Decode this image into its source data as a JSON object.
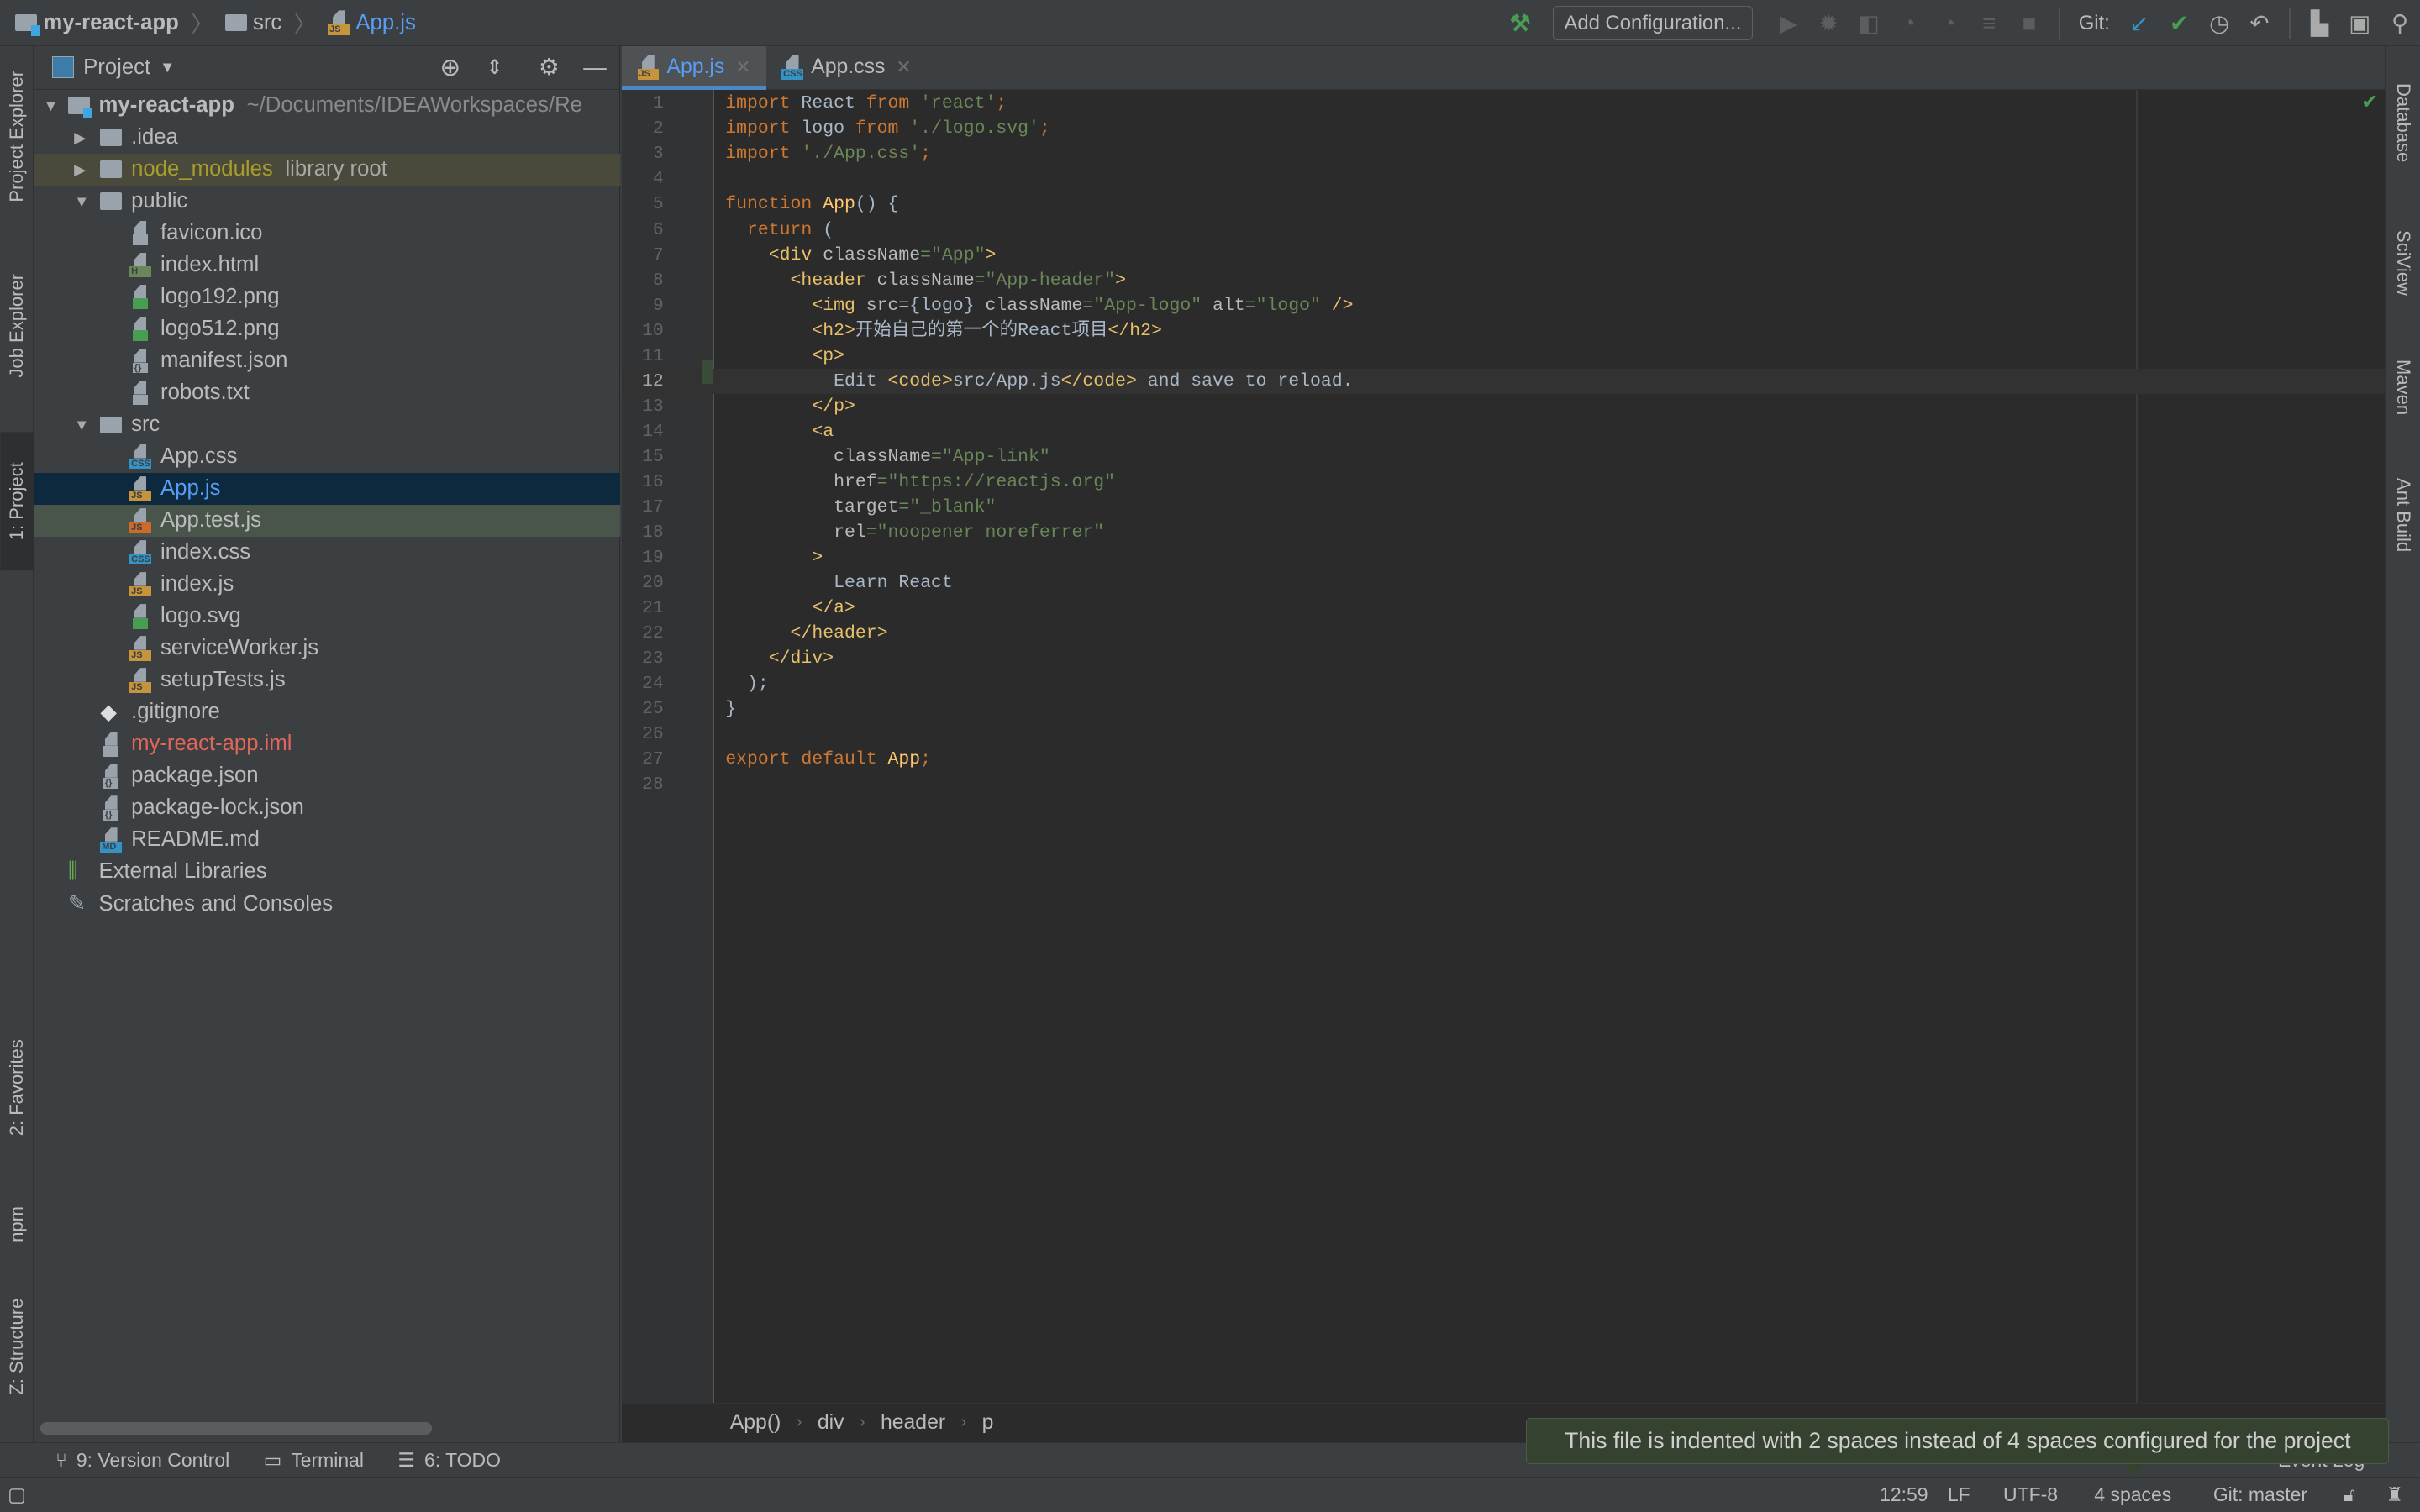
{
  "navbar": {
    "project": "my-react-app",
    "folder": "src",
    "file": "App.js"
  },
  "toolbar": {
    "add_configuration": "Add Configuration...",
    "git_label": "Git:"
  },
  "left_strip": {
    "project_explorer": "Project Explorer",
    "job_explorer": "Job Explorer",
    "project": "1: Project",
    "favorites": "2: Favorites",
    "npm": "npm",
    "structure": "Z: Structure"
  },
  "right_strip": {
    "database": "Database",
    "sciview": "SciView",
    "maven": "Maven",
    "ant_build": "Ant Build"
  },
  "project_panel": {
    "title": "Project",
    "tree": [
      {
        "depth": 0,
        "arrow": "open",
        "icon": "module",
        "name": "my-react-app",
        "bold": true,
        "extra": "~/Documents/IDEAWorkspaces/Re"
      },
      {
        "depth": 1,
        "arrow": "closed",
        "icon": "folder",
        "name": ".idea"
      },
      {
        "depth": 1,
        "arrow": "closed",
        "icon": "folder",
        "name": "node_modules",
        "extra": "library root",
        "state": "excluded"
      },
      {
        "depth": 1,
        "arrow": "open",
        "icon": "folder",
        "name": "public"
      },
      {
        "depth": 2,
        "icon": "gen",
        "name": "favicon.ico"
      },
      {
        "depth": 2,
        "icon": "html",
        "name": "index.html"
      },
      {
        "depth": 2,
        "icon": "img",
        "name": "logo192.png"
      },
      {
        "depth": 2,
        "icon": "img",
        "name": "logo512.png"
      },
      {
        "depth": 2,
        "icon": "json",
        "name": "manifest.json"
      },
      {
        "depth": 2,
        "icon": "gen",
        "name": "robots.txt"
      },
      {
        "depth": 1,
        "arrow": "open",
        "icon": "folder",
        "name": "src"
      },
      {
        "depth": 2,
        "icon": "css",
        "name": "App.css"
      },
      {
        "depth": 2,
        "icon": "js",
        "name": "App.js",
        "state": "selected"
      },
      {
        "depth": 2,
        "icon": "jt",
        "name": "App.test.js",
        "state": "test"
      },
      {
        "depth": 2,
        "icon": "css",
        "name": "index.css"
      },
      {
        "depth": 2,
        "icon": "js",
        "name": "index.js"
      },
      {
        "depth": 2,
        "icon": "img",
        "name": "logo.svg"
      },
      {
        "depth": 2,
        "icon": "js",
        "name": "serviceWorker.js"
      },
      {
        "depth": 2,
        "icon": "js",
        "name": "setupTests.js"
      },
      {
        "depth": 1,
        "icon": "git",
        "name": ".gitignore"
      },
      {
        "depth": 1,
        "icon": "gen",
        "name": "my-react-app.iml",
        "state": "error"
      },
      {
        "depth": 1,
        "icon": "json",
        "name": "package.json"
      },
      {
        "depth": 1,
        "icon": "json",
        "name": "package-lock.json"
      },
      {
        "depth": 1,
        "icon": "md",
        "name": "README.md"
      },
      {
        "depth": 0,
        "icon": "lib",
        "name": "External Libraries"
      },
      {
        "depth": 0,
        "icon": "scratch",
        "name": "Scratches and Consoles"
      }
    ]
  },
  "editor": {
    "tabs": [
      {
        "label": "App.js",
        "icon": "js",
        "active": true
      },
      {
        "label": "App.css",
        "icon": "css",
        "active": false
      }
    ],
    "current_line": 12,
    "lines": [
      [
        [
          "kw",
          "import "
        ],
        [
          "txt",
          "React "
        ],
        [
          "kw",
          "from "
        ],
        [
          "str",
          "'react'"
        ],
        [
          "kw",
          ";"
        ]
      ],
      [
        [
          "kw",
          "import "
        ],
        [
          "txt",
          "logo "
        ],
        [
          "kw",
          "from "
        ],
        [
          "str",
          "'./logo.svg'"
        ],
        [
          "kw",
          ";"
        ]
      ],
      [
        [
          "kw",
          "import "
        ],
        [
          "str",
          "'./App.css'"
        ],
        [
          "kw",
          ";"
        ]
      ],
      [],
      [
        [
          "kw",
          "function "
        ],
        [
          "fn",
          "App"
        ],
        [
          "txt",
          "() {"
        ]
      ],
      [
        [
          "txt",
          "  "
        ],
        [
          "kw",
          "return "
        ],
        [
          "txt",
          "("
        ]
      ],
      [
        [
          "txt",
          "    "
        ],
        [
          "tag",
          "<div "
        ],
        [
          "attr",
          "className"
        ],
        [
          "str",
          "=\"App\""
        ],
        [
          "tag",
          ">"
        ]
      ],
      [
        [
          "txt",
          "      "
        ],
        [
          "tag",
          "<header "
        ],
        [
          "attr",
          "className"
        ],
        [
          "str",
          "=\"App-header\""
        ],
        [
          "tag",
          ">"
        ]
      ],
      [
        [
          "txt",
          "        "
        ],
        [
          "tag",
          "<img "
        ],
        [
          "attr",
          "src"
        ],
        [
          "txt",
          "={logo} "
        ],
        [
          "attr",
          "className"
        ],
        [
          "str",
          "=\"App-logo\" "
        ],
        [
          "attr",
          "alt"
        ],
        [
          "str",
          "=\"logo\" "
        ],
        [
          "tag",
          "/>"
        ]
      ],
      [
        [
          "txt",
          "        "
        ],
        [
          "tag",
          "<h2>"
        ],
        [
          "txt",
          "开始自己的第一个的React项目"
        ],
        [
          "tag",
          "</h2>"
        ]
      ],
      [
        [
          "txt",
          "        "
        ],
        [
          "tag",
          "<p>"
        ]
      ],
      [
        [
          "txt",
          "          Edit "
        ],
        [
          "tag",
          "<code>"
        ],
        [
          "txt",
          "src/App.js"
        ],
        [
          "tag",
          "</code>"
        ],
        [
          "txt",
          " and save to reload."
        ]
      ],
      [
        [
          "txt",
          "        "
        ],
        [
          "tag",
          "</p>"
        ]
      ],
      [
        [
          "txt",
          "        "
        ],
        [
          "tag",
          "<a"
        ]
      ],
      [
        [
          "txt",
          "          "
        ],
        [
          "attr",
          "className"
        ],
        [
          "str",
          "=\"App-link\""
        ]
      ],
      [
        [
          "txt",
          "          "
        ],
        [
          "attr",
          "href"
        ],
        [
          "str",
          "=\"https://reactjs.org\""
        ]
      ],
      [
        [
          "txt",
          "          "
        ],
        [
          "attr",
          "target"
        ],
        [
          "str",
          "=\"_blank\""
        ]
      ],
      [
        [
          "txt",
          "          "
        ],
        [
          "attr",
          "rel"
        ],
        [
          "str",
          "=\"noopener noreferrer\""
        ]
      ],
      [
        [
          "txt",
          "        "
        ],
        [
          "tag",
          ">"
        ]
      ],
      [
        [
          "txt",
          "          Learn React"
        ]
      ],
      [
        [
          "txt",
          "        "
        ],
        [
          "tag",
          "</a>"
        ]
      ],
      [
        [
          "txt",
          "      "
        ],
        [
          "tag",
          "</header>"
        ]
      ],
      [
        [
          "txt",
          "    "
        ],
        [
          "tag",
          "</div>"
        ]
      ],
      [
        [
          "txt",
          "  );"
        ]
      ],
      [
        [
          "txt",
          "}"
        ]
      ],
      [],
      [
        [
          "kw",
          "export default "
        ],
        [
          "fn",
          "App"
        ],
        [
          "kw",
          ";"
        ]
      ],
      []
    ],
    "breadcrumbs": [
      "App()",
      "div",
      "header",
      "p"
    ]
  },
  "bottom_bar": {
    "version_control": "9: Version Control",
    "terminal": "Terminal",
    "todo": "6: TODO",
    "event_log": "Event Log"
  },
  "status": {
    "position": "12:59",
    "line_sep": "LF",
    "encoding": "UTF-8",
    "indent": "4 spaces",
    "git_branch": "Git: master"
  },
  "tooltip": "This file is indented with 2 spaces instead of 4 spaces configured for the project",
  "colors": {
    "keyword": "#cc7832",
    "string": "#6a8759",
    "tag": "#e8bf6a",
    "selection": "#0d293e",
    "accent": "#4a88c7"
  }
}
